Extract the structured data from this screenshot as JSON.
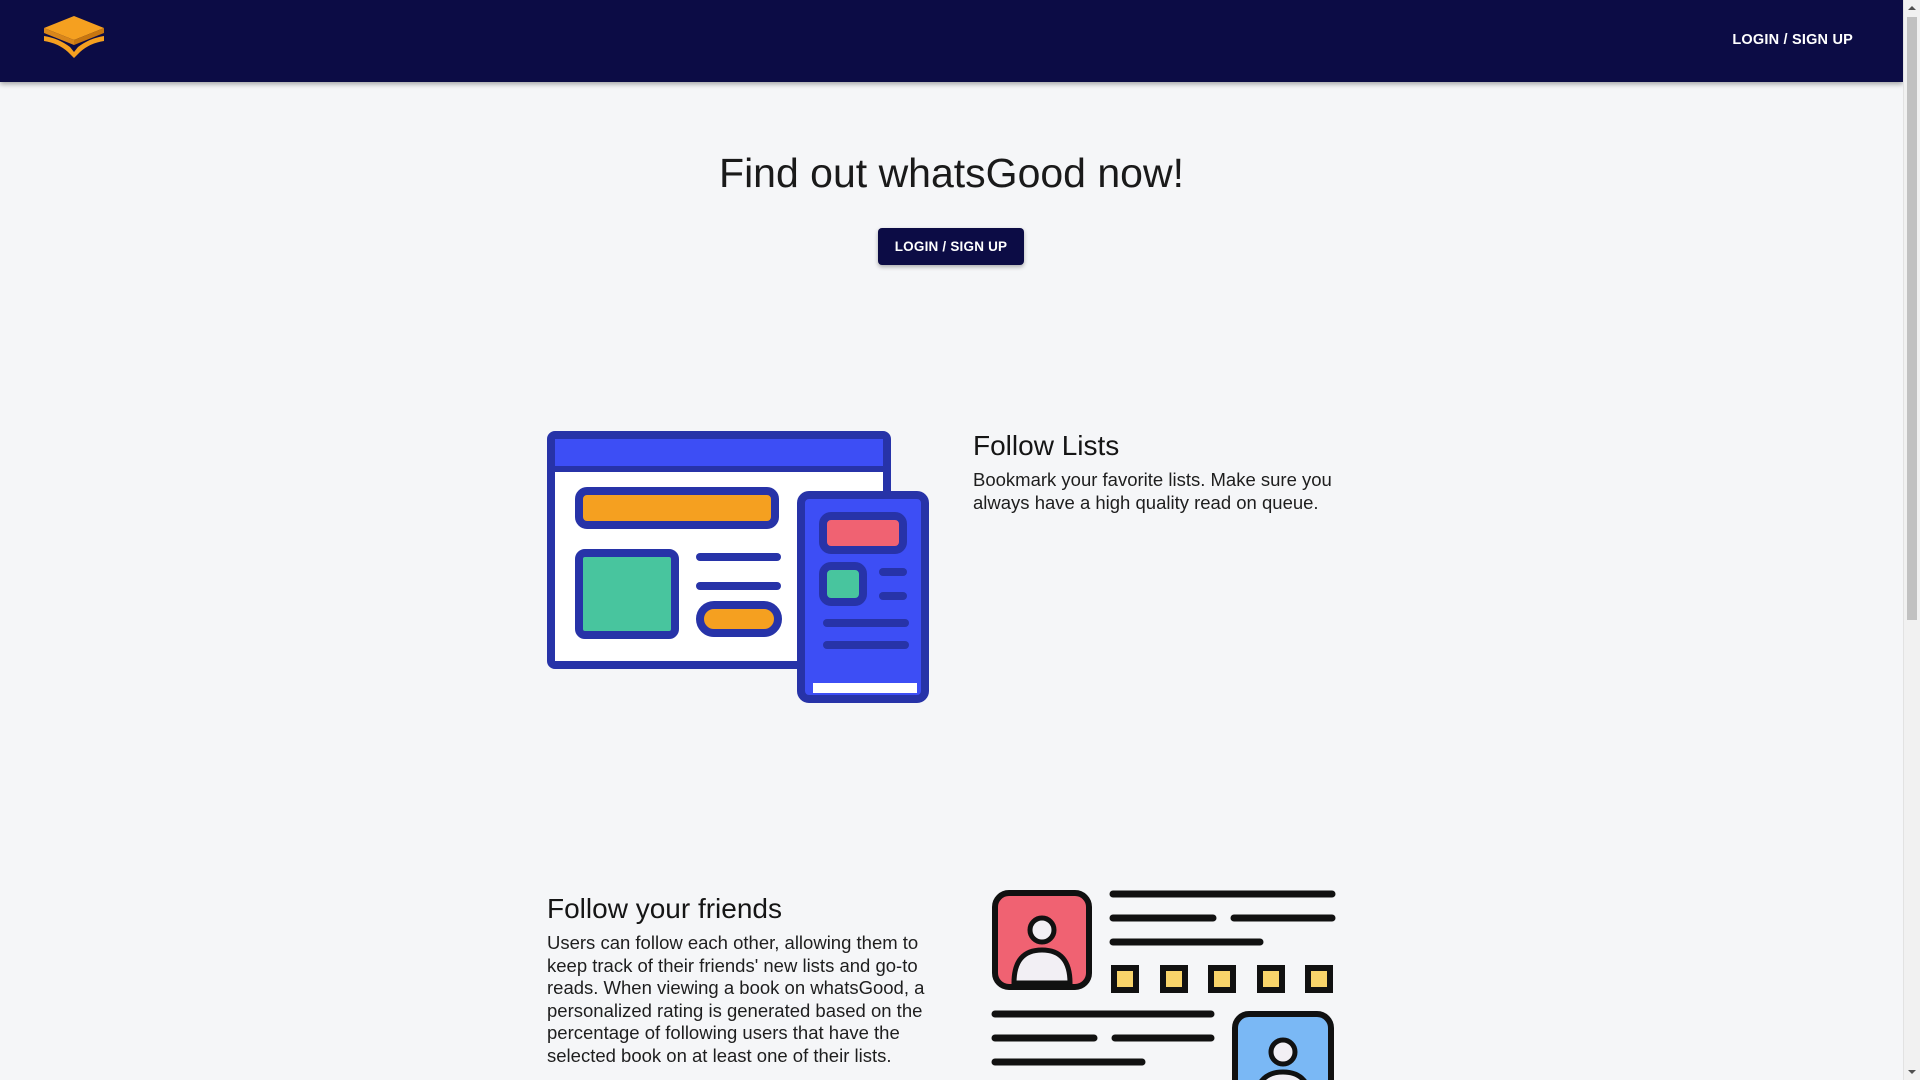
{
  "colors": {
    "appbar": "#0c0c45",
    "page_background": "#f5f6f8",
    "accent_orange": "#f5a020",
    "illustration_blue": "#3d4ef5",
    "illustration_navy": "#2733a8",
    "illustration_green": "#48c59e",
    "illustration_red": "#f06272"
  },
  "header": {
    "logo_icon": "book-stack-icon",
    "login_label": "LOGIN / SIGN UP"
  },
  "hero": {
    "title": "Find out whatsGood now!",
    "cta_label": "LOGIN / SIGN UP"
  },
  "features": [
    {
      "title": "Follow Lists",
      "text": "Bookmark your favorite lists. Make sure you always have a high quality read on queue.",
      "icon": "lists-browser-icon"
    },
    {
      "title": "Follow your friends",
      "text": "Users can follow each other, allowing them to keep track of their friends' new lists and go-to reads. When viewing a book on whatsGood, a personalized rating is generated based on the percentage of following users that have the selected book on at least one of their lists.",
      "icon": "friends-profiles-icon"
    }
  ],
  "scrollbar": {
    "up_icon": "scroll-up-arrow-icon",
    "down_icon": "scroll-down-arrow-icon"
  }
}
